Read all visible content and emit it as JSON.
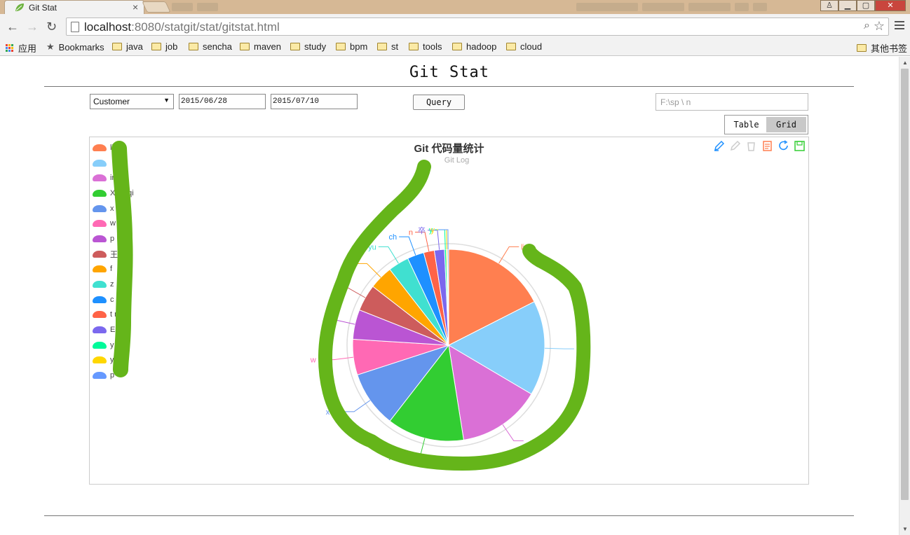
{
  "browser": {
    "tab_title": "Git Stat",
    "tab_close": "×",
    "url_host": "localhost",
    "url_rest": ":8080/statgit/stat/gitstat.html",
    "bookmarks": [
      {
        "label": "应用",
        "kind": "apps"
      },
      {
        "label": "Bookmarks",
        "kind": "star"
      },
      {
        "label": "java",
        "kind": "folder"
      },
      {
        "label": "job",
        "kind": "folder"
      },
      {
        "label": "sencha",
        "kind": "folder"
      },
      {
        "label": "maven",
        "kind": "folder"
      },
      {
        "label": "study",
        "kind": "folder"
      },
      {
        "label": "bpm",
        "kind": "folder"
      },
      {
        "label": "st",
        "kind": "folder"
      },
      {
        "label": "tools",
        "kind": "folder"
      },
      {
        "label": "hadoop",
        "kind": "folder"
      },
      {
        "label": "cloud",
        "kind": "folder"
      }
    ],
    "other_bookmarks": "其他书签"
  },
  "page": {
    "title": "Git Stat",
    "filter": {
      "group_by": "Customer",
      "date_from": "2015/06/28",
      "date_to": "2015/07/10",
      "query_label": "Query",
      "path_value": "F:\\sp    \\                  n"
    },
    "view_toggle": {
      "table": "Table",
      "grid": "Grid",
      "active": "grid"
    }
  },
  "chart_data": {
    "type": "pie",
    "title": "Git 代码量统计",
    "subtitle": "Git Log",
    "legend_position": "top-left",
    "legend": [
      {
        "name": "li",
        "color": "#ff7f50"
      },
      {
        "name": "",
        "color": "#87cefa"
      },
      {
        "name": "in",
        "color": "#da70d6"
      },
      {
        "name": "Xi  enqi",
        "color": "#32cd32"
      },
      {
        "name": "x    ian",
        "color": "#6495ed"
      },
      {
        "name": "w    s",
        "color": "#ff69b4"
      },
      {
        "name": "p",
        "color": "#ba55d3"
      },
      {
        "name": "王",
        "color": "#cd5c5c"
      },
      {
        "name": "f",
        "color": "#ffa500"
      },
      {
        "name": "z",
        "color": "#40e0d0"
      },
      {
        "name": "c    qw",
        "color": "#1e90ff"
      },
      {
        "name": "t    n",
        "color": "#ff6347"
      },
      {
        "name": "E    ",
        "color": "#7b68ee"
      },
      {
        "name": "y    d3",
        "color": "#00fa9a"
      },
      {
        "name": "y    y",
        "color": "#ffd700"
      },
      {
        "name": "p",
        "color": "#6699ff"
      }
    ],
    "slices": [
      {
        "label": "li",
        "value": 17.5,
        "color": "#ff7f50"
      },
      {
        "label": "",
        "value": 16.0,
        "color": "#87cefa"
      },
      {
        "label": "",
        "value": 14.0,
        "color": "#da70d6"
      },
      {
        "label": "Xi   nqi",
        "value": 13.0,
        "color": "#32cd32"
      },
      {
        "label": "x   ian",
        "value": 9.5,
        "color": "#6495ed"
      },
      {
        "label": "w   s",
        "value": 6.0,
        "color": "#ff69b4"
      },
      {
        "label": "",
        "value": 5.0,
        "color": "#ba55d3"
      },
      {
        "label": "",
        "value": 4.5,
        "color": "#cd5c5c"
      },
      {
        "label": "u",
        "value": 4.0,
        "color": "#ffa500"
      },
      {
        "label": "  yu",
        "value": 3.5,
        "color": "#40e0d0"
      },
      {
        "label": "ch",
        "value": 2.8,
        "color": "#1e90ff"
      },
      {
        "label": "n",
        "value": 1.8,
        "color": "#ff6347"
      },
      {
        "label": "卒",
        "value": 1.7,
        "color": "#7b68ee"
      },
      {
        "label": "y",
        "value": 0.3,
        "color": "#00fa9a"
      },
      {
        "label": "y",
        "value": 0.2,
        "color": "#ffd700"
      },
      {
        "label": "",
        "value": 0.2,
        "color": "#6699ff"
      }
    ]
  }
}
